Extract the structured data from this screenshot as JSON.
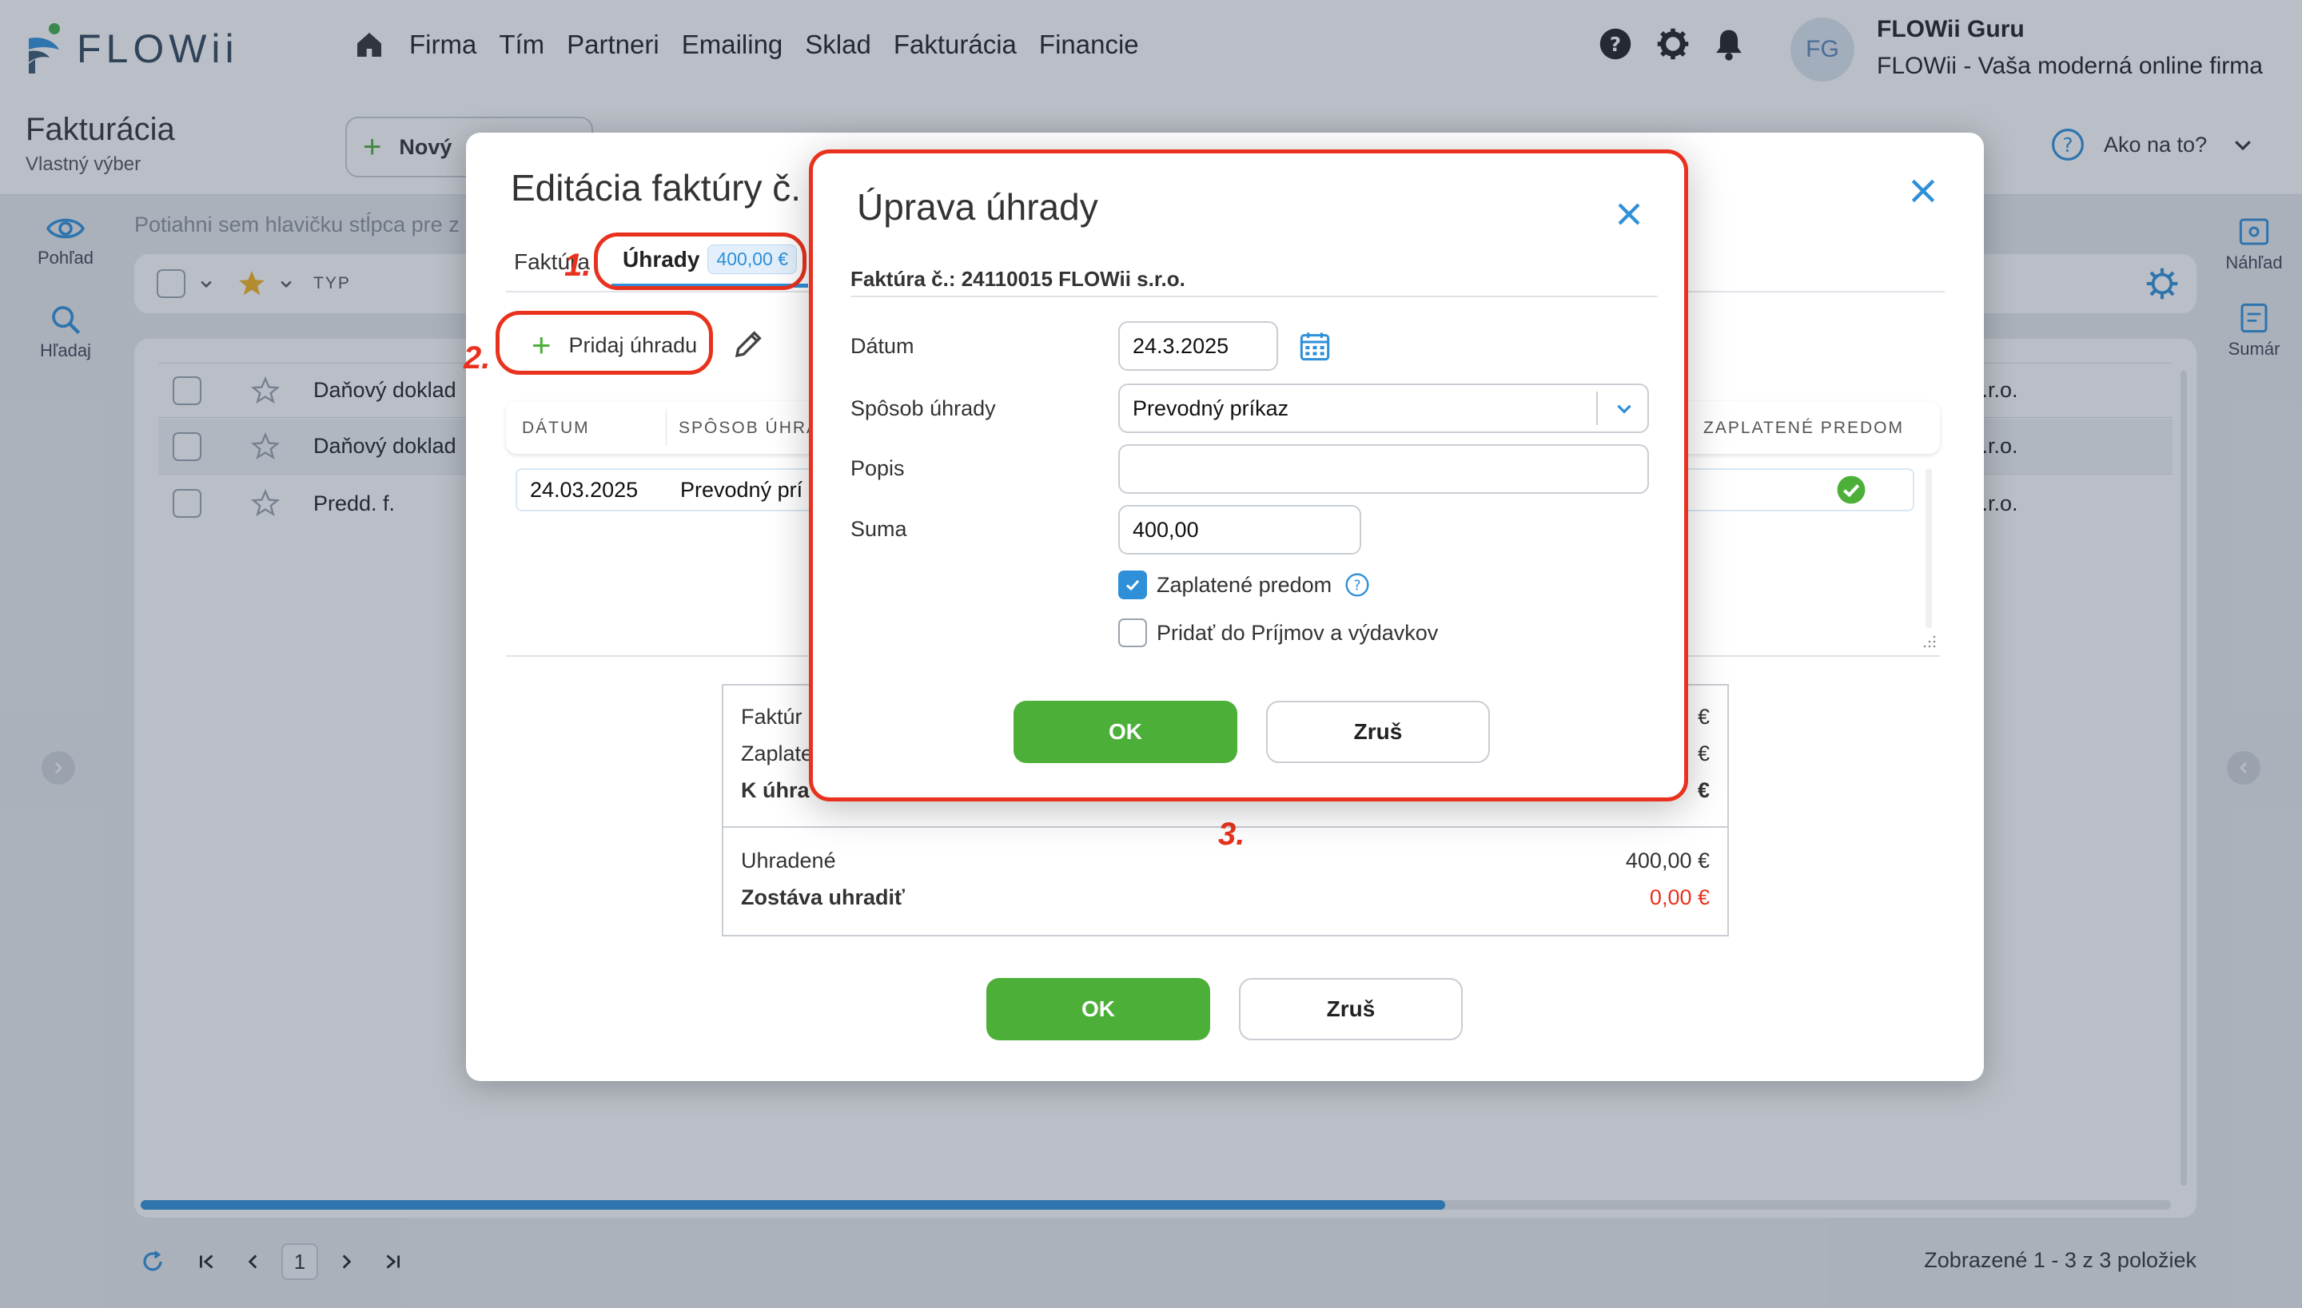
{
  "header": {
    "logo_text": "FLOWii",
    "nav": [
      "Firma",
      "Tím",
      "Partneri",
      "Emailing",
      "Sklad",
      "Fakturácia",
      "Financie"
    ],
    "avatar_initials": "FG",
    "user_name": "FLOWii Guru",
    "company_name": "FLOWii - Vaša moderná online firma"
  },
  "subheader": {
    "title": "Fakturácia",
    "subtitle": "Vlastný výber",
    "new_button": "Nový",
    "help_label": "Ako na to?"
  },
  "left_tools": {
    "view": "Pohľad",
    "search": "Hľadaj"
  },
  "right_tools": {
    "preview": "Náhľad",
    "summary": "Sumár"
  },
  "grid": {
    "group_hint": "Potiahni sem hlavičku stĺpca pre z",
    "col_type": "TYP",
    "rows": [
      {
        "type": "Daňový doklad",
        "partner": "s.r.o."
      },
      {
        "type": "Daňový doklad",
        "partner": "s.r.o."
      },
      {
        "type": "Predd. f.",
        "partner": "s.r.o."
      }
    ]
  },
  "pagination": {
    "page": "1",
    "summary": "Zobrazené 1 - 3 z 3 položiek"
  },
  "outer_modal": {
    "title": "Editácia faktúry č.",
    "tab_invoice": "Faktúra",
    "tab_payments": "Úhrady",
    "tab_payments_badge": "400,00 €",
    "add_payment": "Pridaj úhradu",
    "table_headers": {
      "date": "DÁTUM",
      "method": "SPÔSOB ÚHRA",
      "prepaid": "ZAPLATENÉ PREDOM"
    },
    "row": {
      "date": "24.03.2025",
      "method": "Prevodný prí"
    },
    "summary": {
      "invoice_label": "Faktúr",
      "invoice_value": "€",
      "paid_label": "Zaplate",
      "paid_value": "€",
      "due_label": "K úhra",
      "due_value": "€",
      "covered_label": "Uhradené",
      "covered_value": "400,00 €",
      "remaining_label": "Zostáva uhradiť",
      "remaining_value": "0,00 €"
    },
    "ok": "OK",
    "cancel": "Zruš"
  },
  "inner_modal": {
    "title": "Úprava úhrady",
    "invoice_info": "Faktúra č.: 24110015 FLOWii s.r.o.",
    "date_label": "Dátum",
    "date_value": "24.3.2025",
    "method_label": "Spôsob úhrady",
    "method_value": "Prevodný príkaz",
    "description_label": "Popis",
    "description_value": "",
    "amount_label": "Suma",
    "amount_value": "400,00",
    "prepaid_label": "Zaplatené predom",
    "prepaid_checked": true,
    "income_label": "Pridať do Príjmov a výdavkov",
    "income_checked": false,
    "ok": "OK",
    "cancel": "Zruš"
  },
  "annotations": {
    "step1": "1.",
    "step2": "2.",
    "step3": "3."
  },
  "colors": {
    "accent_green": "#4caf38",
    "accent_red": "#e8321e",
    "accent_blue": "#2f8fd8"
  }
}
